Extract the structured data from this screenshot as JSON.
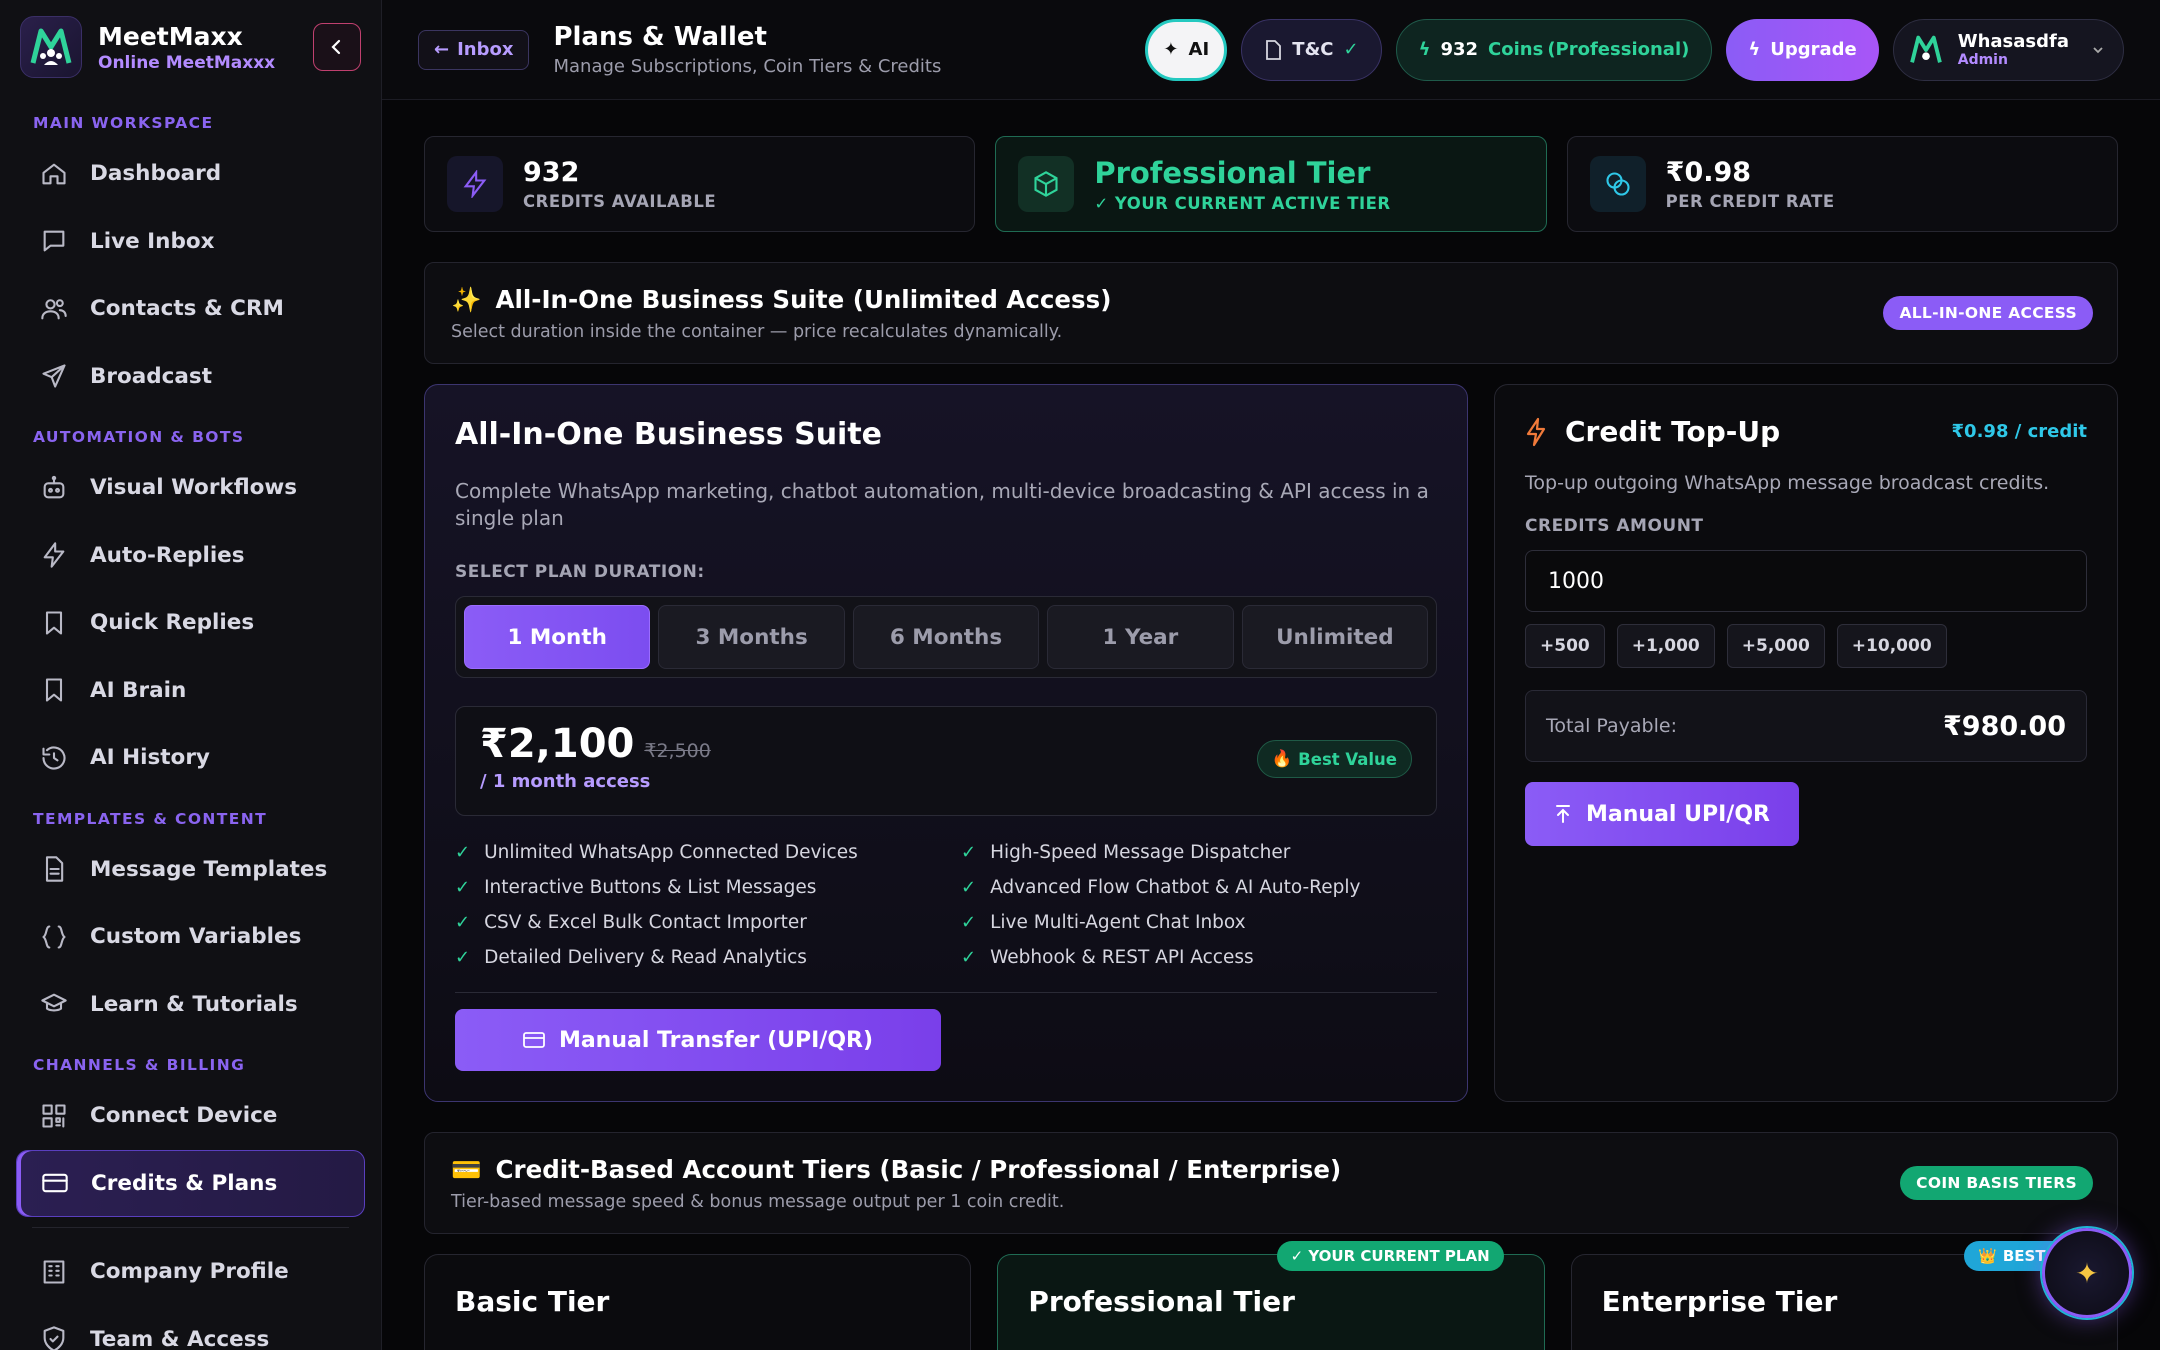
{
  "brand": {
    "name": "MeetMaxx",
    "subtitle": "Online MeetMaxxx"
  },
  "sidebar": {
    "sections": [
      {
        "title": "MAIN WORKSPACE",
        "items": [
          "Dashboard",
          "Live Inbox",
          "Contacts & CRM",
          "Broadcast"
        ]
      },
      {
        "title": "AUTOMATION & BOTS",
        "items": [
          "Visual Workflows",
          "Auto-Replies",
          "Quick Replies",
          "AI Brain",
          "AI History"
        ]
      },
      {
        "title": "TEMPLATES & CONTENT",
        "items": [
          "Message Templates",
          "Custom Variables",
          "Learn & Tutorials"
        ]
      },
      {
        "title": "CHANNELS & BILLING",
        "items": [
          "Connect Device",
          "Credits & Plans"
        ]
      }
    ],
    "bottom_items": [
      "Company Profile",
      "Team & Access"
    ],
    "active": "Credits & Plans"
  },
  "topbar": {
    "back_label": "Inbox",
    "title": "Plans & Wallet",
    "subtitle": "Manage Subscriptions, Coin Tiers & Credits",
    "ai_label": "AI",
    "tc_label": "T&C",
    "coins_count": "932",
    "coins_label": "Coins",
    "coins_tier": "(Professional)",
    "upgrade_label": "Upgrade",
    "user_name": "Whasasdfa",
    "user_role": "Admin"
  },
  "stats": [
    {
      "value": "932",
      "label": "CREDITS AVAILABLE"
    },
    {
      "value": "Professional Tier",
      "label": "✓ YOUR CURRENT ACTIVE TIER"
    },
    {
      "value": "₹0.98",
      "label": "PER CREDIT RATE"
    }
  ],
  "suite_banner": {
    "title": "All-In-One Business Suite (Unlimited Access)",
    "subtitle": "Select duration inside the container — price recalculates dynamically.",
    "badge": "ALL-IN-ONE ACCESS"
  },
  "suite": {
    "title": "All-In-One Business Suite",
    "description": "Complete WhatsApp marketing, chatbot automation, multi-device broadcasting & API access in a single plan",
    "duration_label": "SELECT PLAN DURATION:",
    "durations": [
      "1 Month",
      "3 Months",
      "6 Months",
      "1 Year",
      "Unlimited"
    ],
    "selected_duration": "1 Month",
    "price": "₹2,100",
    "old_price": "₹2,500",
    "period": "/ 1 month access",
    "best_value": "Best Value",
    "features": [
      "Unlimited WhatsApp Connected Devices",
      "High-Speed Message Dispatcher",
      "Interactive Buttons & List Messages",
      "Advanced Flow Chatbot & AI Auto-Reply",
      "CSV & Excel Bulk Contact Importer",
      "Live Multi-Agent Chat Inbox",
      "Detailed Delivery & Read Analytics",
      "Webhook & REST API Access"
    ],
    "pay_label": "Manual Transfer (UPI/QR)"
  },
  "topup": {
    "title": "Credit Top-Up",
    "rate": "₹0.98 / credit",
    "description": "Top-up outgoing WhatsApp message broadcast credits.",
    "amount_label": "CREDITS AMOUNT",
    "amount_value": "1000",
    "chips": [
      "+500",
      "+1,000",
      "+5,000",
      "+10,000"
    ],
    "total_label": "Total Payable:",
    "total_value": "₹980.00",
    "pay_label": "Manual UPI/QR"
  },
  "tiers_banner": {
    "title": "Credit-Based Account Tiers (Basic / Professional / Enterprise)",
    "subtitle": "Tier-based message speed & bonus message output per 1 coin credit.",
    "badge": "COIN BASIS TIERS"
  },
  "tiers": [
    {
      "name": "Basic Tier",
      "tag": ""
    },
    {
      "name": "Professional Tier",
      "tag": "✓ YOUR CURRENT PLAN"
    },
    {
      "name": "Enterprise Tier",
      "tag": "BEST VA"
    }
  ],
  "colors": {
    "accent": "#8b5cf6",
    "success": "#2fd39a",
    "info": "#2fc8e8",
    "background": "#060608"
  }
}
